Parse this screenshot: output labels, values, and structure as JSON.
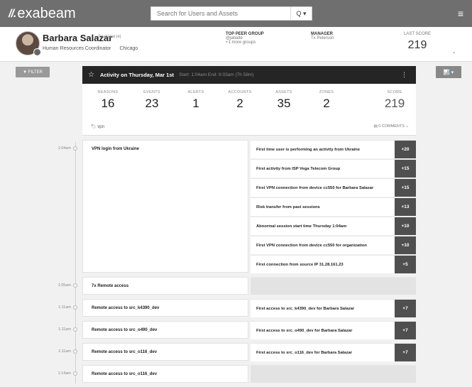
{
  "topbar": {
    "logo_mark": "//.",
    "logo_text": "exabeam",
    "search_placeholder": "Search for Users and Assets",
    "search_btn": "Q ▾",
    "menu_icon": "≡"
  },
  "profile": {
    "name": "Barbara Salazar",
    "tag": "(bsalazar.ie)",
    "title": "Human Resources Coordinator",
    "city": "Chicago",
    "peer_label": "TOP PEER GROUP",
    "peer_value": "@jabalte",
    "peer_sub": "+1 more groups",
    "manager_label": "MANAGER",
    "manager_value": "Tx Peterson",
    "last_score_label": "LAST SCORE",
    "last_score_value": "219"
  },
  "controls": {
    "filter_label": "▼ FILTER",
    "chart_label": "📊 ▾"
  },
  "activity": {
    "title": "Activity on Thursday, Mar 1st",
    "meta": "Start: 1:04am  End: 9:03am (7h 58m)",
    "more": "⋮",
    "stats": [
      {
        "k": "REASONS",
        "v": "16"
      },
      {
        "k": "EVENTS",
        "v": "23"
      },
      {
        "k": "ALERTS",
        "v": "1"
      },
      {
        "k": "ACCOUNTS",
        "v": "2"
      },
      {
        "k": "ASSETS",
        "v": "35"
      },
      {
        "k": "ZONES",
        "v": "2"
      },
      {
        "k": "SCORE",
        "v": "219"
      }
    ],
    "tag": "vpn",
    "comments": "0 COMMENTS ⌄"
  },
  "events": [
    {
      "time": "1:04am",
      "label": "VPN login from Ukraine",
      "reasons": [
        {
          "text": "First time user is performing an activity from Ukraine",
          "score": "+20"
        },
        {
          "text": "First activity from ISP Vega Telecom Group",
          "score": "+15"
        },
        {
          "text": "First VPN connection from device cc550 for Barbara Salazar",
          "score": "+15"
        },
        {
          "text": "Risk transfer from past sessions",
          "score": "+13"
        },
        {
          "text": "Abnormal session start time Thursday 1:04am",
          "score": "+10"
        },
        {
          "text": "First VPN connection from device cc550 for organization",
          "score": "+10"
        },
        {
          "text": "First connection from source IP 31.28.161.23",
          "score": "+5"
        }
      ]
    },
    {
      "time": "1:05am",
      "label": "7x Remote access",
      "reasons": []
    },
    {
      "time": "1:11am",
      "label": "Remote access to src_k4390_dev",
      "reasons": [
        {
          "text": "First access to src_k4390_dev for Barbara Salazar",
          "score": "+7"
        }
      ]
    },
    {
      "time": "1:11am",
      "label": "Remote access to src_o490_dev",
      "reasons": [
        {
          "text": "First access to src_o490_dev for Barbara Salazar",
          "score": "+7"
        }
      ]
    },
    {
      "time": "1:11am",
      "label": "Remote access to src_o116_dev",
      "reasons": [
        {
          "text": "First access to src_o116_dev for Barbara Salazar",
          "score": "+7"
        }
      ]
    },
    {
      "time": "1:14am",
      "label": "Remote access to src_o116_dev",
      "reasons": []
    }
  ]
}
